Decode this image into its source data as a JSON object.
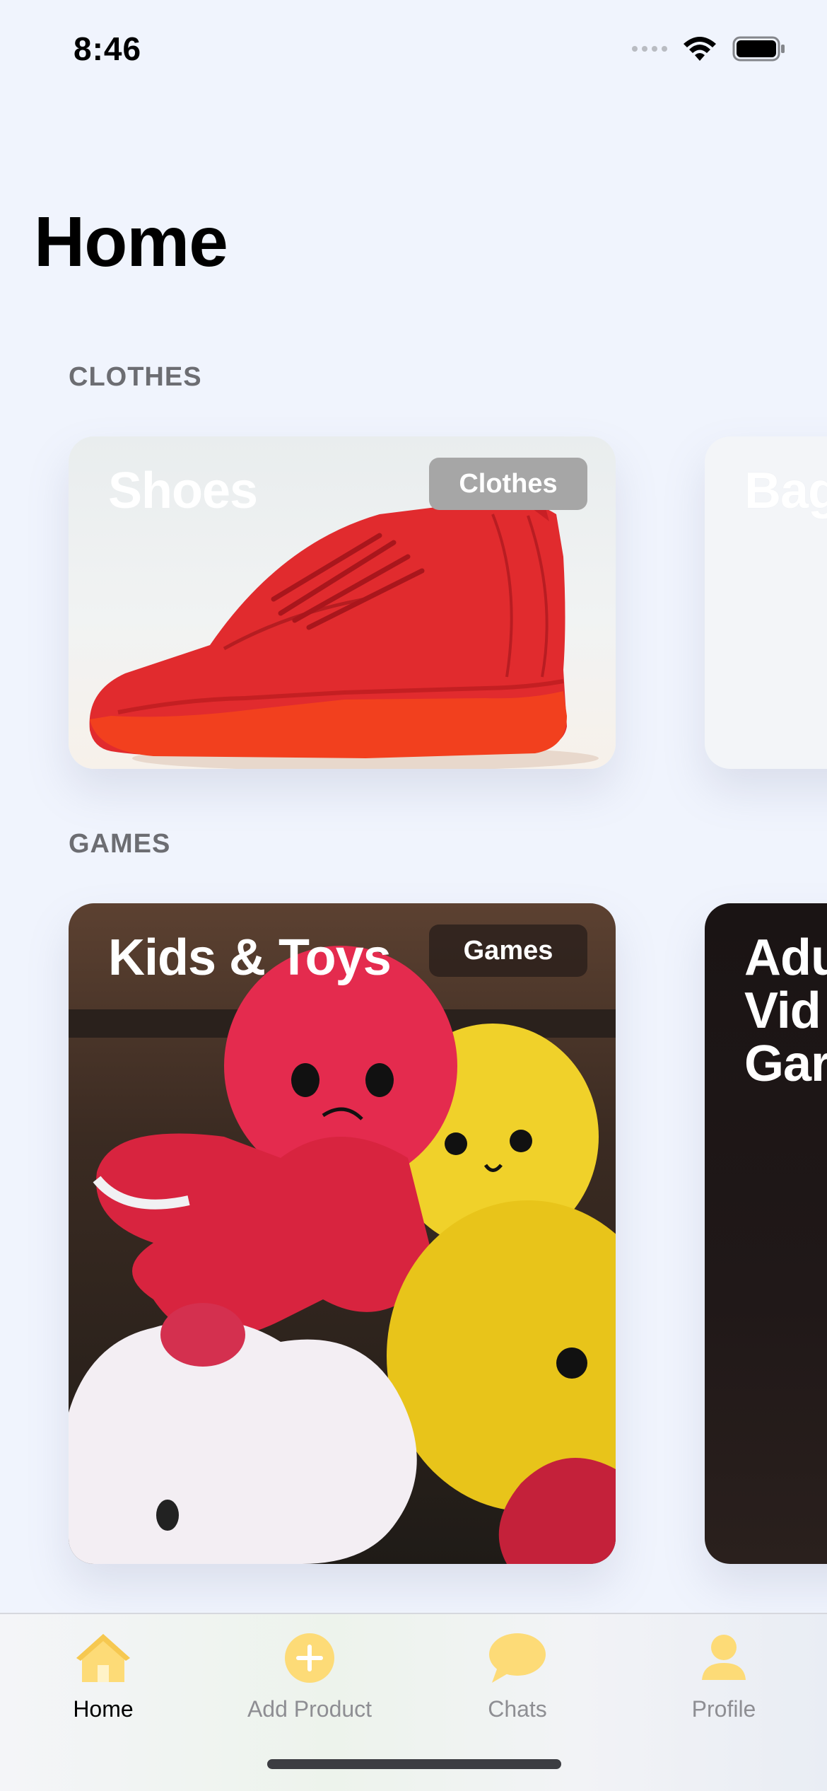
{
  "status": {
    "time": "8:46"
  },
  "page": {
    "title": "Home"
  },
  "sections": [
    {
      "label": "CLOTHES",
      "cards": [
        {
          "title": "Shoes",
          "badge": "Clothes"
        },
        {
          "title": "Bag"
        }
      ]
    },
    {
      "label": "GAMES",
      "cards": [
        {
          "title": "Kids & Toys",
          "badge": "Games"
        },
        {
          "title": "Adu Vid Gar"
        }
      ]
    }
  ],
  "tabbar": {
    "tabs": [
      {
        "label": "Home",
        "icon": "house-icon",
        "active": true
      },
      {
        "label": "Add Product",
        "icon": "plus-circle-icon",
        "active": false
      },
      {
        "label": "Chats",
        "icon": "chat-bubble-icon",
        "active": false
      },
      {
        "label": "Profile",
        "icon": "person-icon",
        "active": false
      }
    ]
  },
  "colors": {
    "background": "#f0f4fd",
    "accent": "#fddb77",
    "badge_light": "#a6a6a6",
    "badge_dark": "#3d2b22",
    "shoe": "#e5212b"
  }
}
